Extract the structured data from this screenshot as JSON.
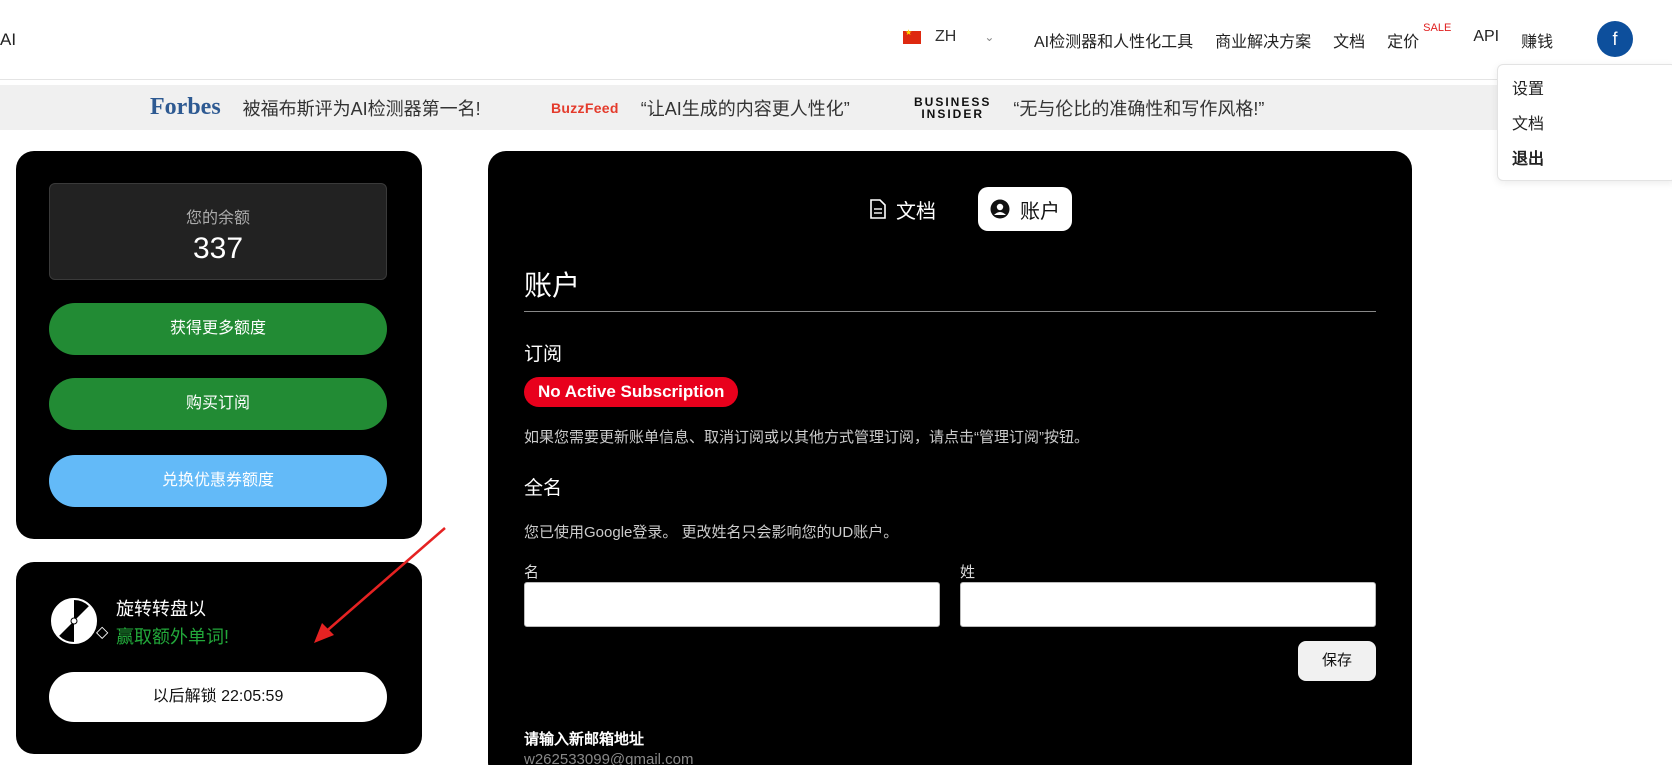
{
  "header": {
    "brand": "AI",
    "language": "ZH",
    "nav": [
      {
        "label": "AI检测器和人性化工具"
      },
      {
        "label": "商业解决方案"
      },
      {
        "label": "文档"
      },
      {
        "label": "定价",
        "badge": "SALE"
      },
      {
        "label": "API"
      },
      {
        "label": "赚钱"
      }
    ],
    "avatar_letter": "f"
  },
  "dropdown": {
    "items": [
      "设置",
      "文档",
      "退出"
    ]
  },
  "press": {
    "items": [
      {
        "logo": "Forbes",
        "quote": "被福布斯评为AI检测器第一名!"
      },
      {
        "logo": "BuzzFeed",
        "quote": "“让AI生成的内容更人性化”"
      },
      {
        "logo_line1": "BUSINESS",
        "logo_line2": "INSIDER",
        "quote": "“无与伦比的准确性和写作风格!”"
      }
    ]
  },
  "sidebar": {
    "balance_label": "您的余额",
    "balance_value": "337",
    "get_more": "获得更多额度",
    "buy_subscription": "购买订阅",
    "redeem_coupon": "兑换优惠券额度",
    "spin_line1": "旋转转盘以",
    "spin_line2": "赢取额外单词!",
    "unlock_button": "以后解锁 22:05:59"
  },
  "main": {
    "tabs": [
      {
        "label": "文档",
        "icon": "document-icon"
      },
      {
        "label": "账户",
        "icon": "user-circle-icon",
        "active": true
      }
    ],
    "title": "账户",
    "subscription_title": "订阅",
    "subscription_badge": "No Active Subscription",
    "subscription_note": "如果您需要更新账单信息、取消订阅或以其他方式管理订阅，请点击“管理订阅”按钮。",
    "fullname_title": "全名",
    "fullname_note": "您已使用Google登录。 更改姓名只会影响您的UD账户。",
    "first_name_label": "名",
    "last_name_label": "姓",
    "first_name_value": "",
    "last_name_value": "",
    "save_button": "保存",
    "email_label": "请输入新邮箱地址",
    "email_value": "w262533099@gmail.com"
  },
  "colors": {
    "green": "#228b34",
    "blue": "#63baf8",
    "red_badge": "#e8001c",
    "avatar": "#0d4f9c"
  }
}
